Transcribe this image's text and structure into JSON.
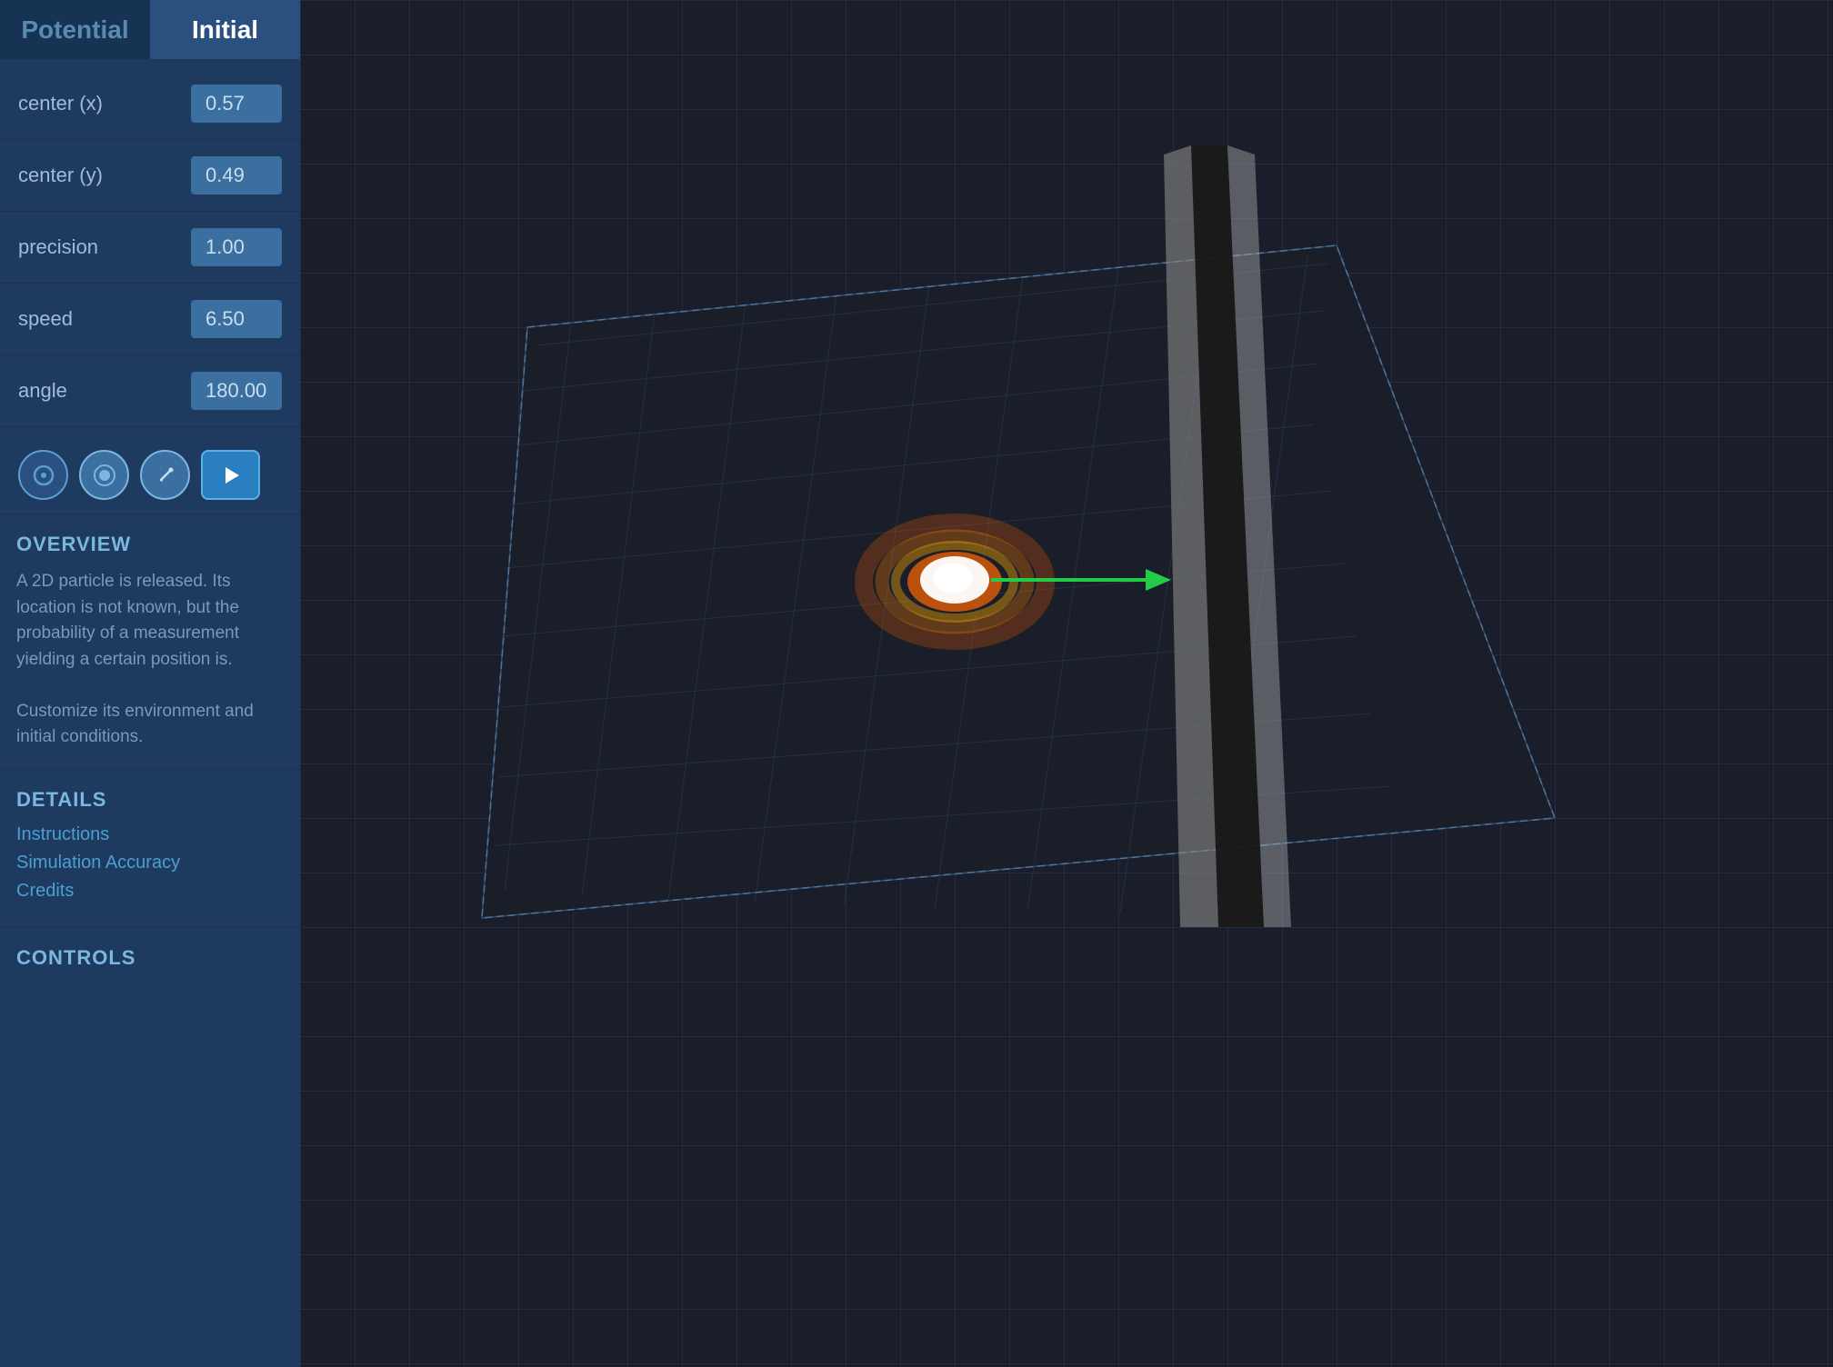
{
  "tabs": [
    {
      "label": "Potential",
      "active": false
    },
    {
      "label": "Initial",
      "active": true
    }
  ],
  "params": [
    {
      "label": "center (x)",
      "value": "0.57"
    },
    {
      "label": "center (y)",
      "value": "0.49"
    },
    {
      "label": "precision",
      "value": "1.00"
    },
    {
      "label": "speed",
      "value": "6.50"
    },
    {
      "label": "angle",
      "value": "180.00"
    }
  ],
  "action_buttons": [
    {
      "icon": "○",
      "type": "circle-outline",
      "label": "add-circle"
    },
    {
      "icon": "◎",
      "type": "circle-solid",
      "label": "select-circle"
    },
    {
      "icon": "✎",
      "type": "pencil",
      "label": "edit"
    },
    {
      "icon": "▶",
      "type": "play",
      "label": "play"
    }
  ],
  "overview": {
    "title": "OVERVIEW",
    "text": "A 2D particle is released.  Its location is not known, but the probability of a measurement yielding a certain position is.\nCustomize its environment and initial conditions."
  },
  "details": {
    "title": "DETAILS",
    "links": [
      "Instructions",
      "Simulation Accuracy",
      "Credits"
    ]
  },
  "controls": {
    "title": "CONTROLS"
  }
}
